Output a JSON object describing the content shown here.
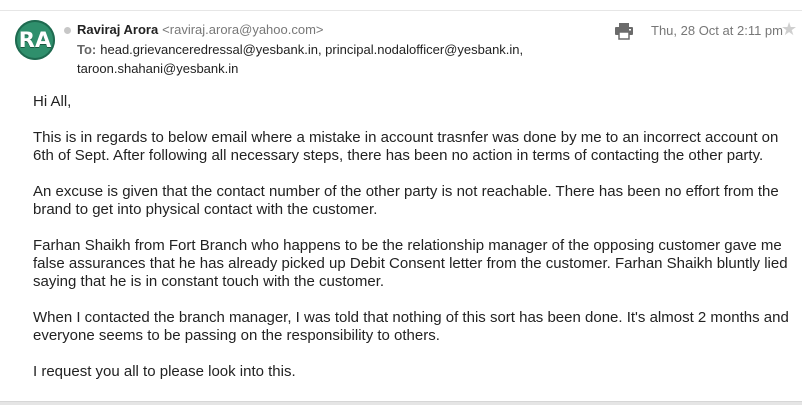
{
  "email": {
    "avatar_initials": "RA",
    "sender_name": "Raviraj Arora",
    "sender_email": "<raviraj.arora@yahoo.com>",
    "to_label": "To:",
    "recipients": "head.grievanceredressal@yesbank.in,  principal.nodalofficer@yesbank.in, taroon.shahani@yesbank.in",
    "date": "Thu, 28 Oct at 2:11 pm",
    "icons": [
      "printer-icon",
      "star-icon"
    ],
    "colors": {
      "avatar": "#2f8f6c",
      "secondary_text": "#777777"
    }
  },
  "body": {
    "greeting": "Hi All,",
    "paragraphs": [
      "This is in regards to below email where a mistake in account trasnfer was done by me to an incorrect account on 6th of Sept. After following all necessary steps, there has been no action in terms of contacting the other party.",
      "An excuse is given that the contact number of the other party is not reachable. There has been no effort from the brand to get into physical contact with the customer.",
      "Farhan Shaikh from Fort Branch who happens to be the relationship manager of the opposing customer gave me false assurances that he has already picked up Debit Consent letter from the customer. Farhan Shaikh bluntly lied saying that he is in constant touch with the customer.",
      "When I contacted the branch manager, I was told that nothing of this sort has been done. It's almost 2 months and everyone seems to be passing on the responsibility to others."
    ],
    "closing": "I request you all to please look into this."
  }
}
